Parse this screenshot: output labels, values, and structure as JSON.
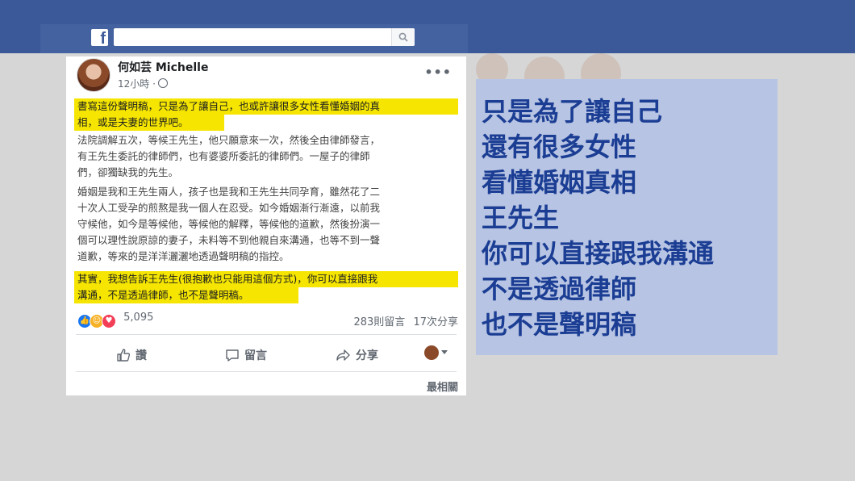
{
  "header": {
    "logo_letter": "f",
    "search_placeholder": ""
  },
  "post": {
    "author": "何如芸 Michelle",
    "time": "12小時",
    "more": "•••",
    "paragraphs": [
      {
        "lines": [
          "書寫這份聲明稿，只是為了讓自己，也或許讓很多女性看懂婚姻的真",
          "相，或是夫妻的世界吧。"
        ]
      },
      {
        "lines": [
          "法院調解五次，等候王先生，他只願意來一次，然後全由律師發言，",
          "有王先生委託的律師們，也有婆婆所委託的律師們。一屋子的律師",
          "們，卻獨缺我的先生。"
        ]
      },
      {
        "lines": [
          "婚姻是我和王先生兩人，孩子也是我和王先生共同孕育，雖然花了二",
          "十次人工受孕的煎熬是我一個人在忍受。如今婚姻漸行漸遠，以前我",
          "守候他，如今是等候他，等候他的解釋，等候他的道歉，然後扮演一",
          "個可以理性說原諒的妻子，未料等不到他親自來溝通，也等不到一聲",
          "道歉，等來的是洋洋灑灑地透過聲明稿的指控。"
        ]
      },
      {
        "lines": [
          "其實，我想告訴王先生(很抱歉也只能用這個方式)，你可以直接跟我",
          "溝通，不是透過律師，也不是聲明稿。"
        ]
      }
    ],
    "reaction_count": "5,095",
    "comments": "283則留言",
    "shares": "17次分享",
    "actions": {
      "like": "讚",
      "comment": "留言",
      "share": "分享"
    },
    "sort": "最相關"
  },
  "caption": {
    "lines": [
      "只是為了讓自己",
      "還有很多女性",
      "看懂婚姻真相",
      "王先生",
      "你可以直接跟我溝通",
      "不是透過律師",
      "也不是聲明稿"
    ]
  },
  "colors": {
    "facebook_blue": "#3b5998",
    "highlight_yellow": "#f5e500",
    "caption_bg": "#b8c4e3",
    "caption_text": "#1b3e94"
  },
  "icons": [
    "facebook-logo-icon",
    "search-icon",
    "globe-icon",
    "more-icon",
    "like-reaction-icon",
    "care-reaction-icon",
    "love-reaction-icon",
    "thumbs-up-icon",
    "comment-icon",
    "share-icon",
    "chevron-down-icon"
  ]
}
